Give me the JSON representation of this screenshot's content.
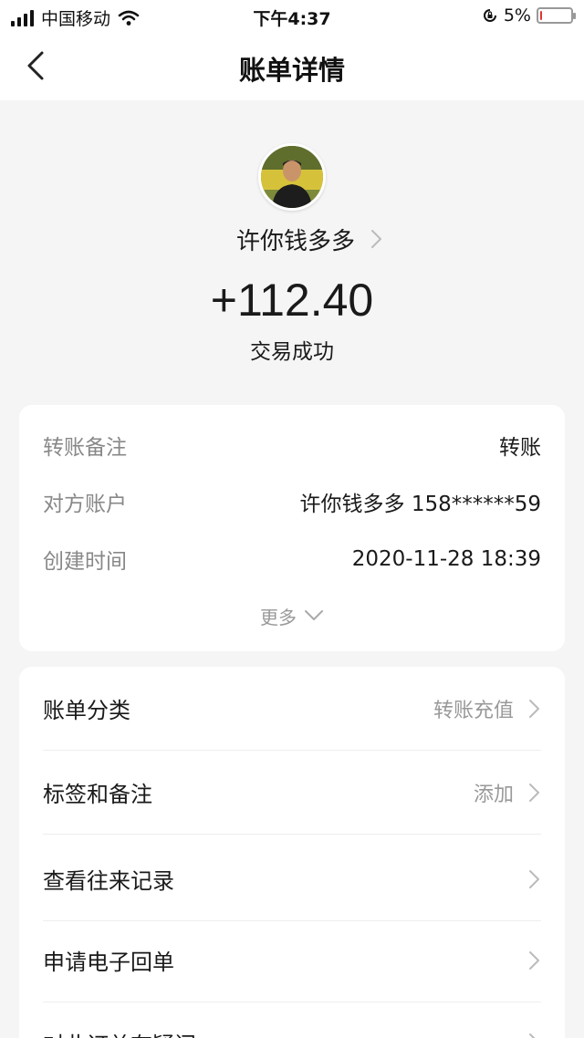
{
  "status_bar": {
    "carrier": "中国移动",
    "time": "下午4:37",
    "battery": "5%",
    "battery_level": 0.05,
    "battery_color": "#e33333"
  },
  "nav": {
    "title": "账单详情"
  },
  "header": {
    "payee_name": "许你钱多多",
    "amount": "+112.40",
    "status": "交易成功"
  },
  "details": {
    "rows": [
      {
        "label": "转账备注",
        "value": "转账"
      },
      {
        "label": "对方账户",
        "value": "许你钱多多 158******59"
      },
      {
        "label": "创建时间",
        "value": "2020-11-28 18:39"
      }
    ],
    "more_label": "更多"
  },
  "menu": {
    "items": [
      {
        "label": "账单分类",
        "value": "转账充值"
      },
      {
        "label": "标签和备注",
        "value": "添加"
      },
      {
        "label": "查看往来记录",
        "value": ""
      },
      {
        "label": "申请电子回单",
        "value": ""
      },
      {
        "label": "对此订单有疑问",
        "value": ""
      }
    ]
  }
}
